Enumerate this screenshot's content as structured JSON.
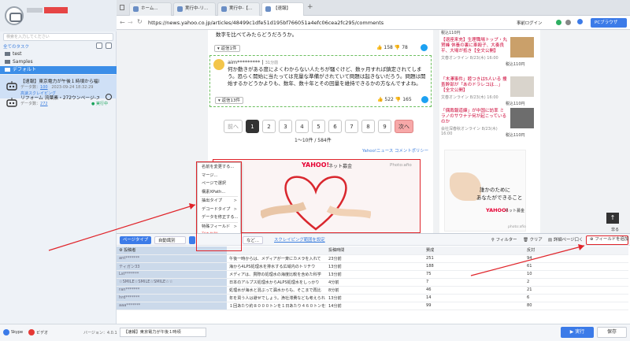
{
  "sidebar": {
    "search_placeholder": "検索を入力してください",
    "section_label": "全てのタスク",
    "folders": [
      "test",
      "Samples",
      "デフォルト"
    ],
    "tasks": [
      {
        "title": "【速報】東京電力が午後１時頃から福島第...",
        "meta_label": "データ数：",
        "meta_count": "100",
        "meta_time": "2023-09-24 18:32:29",
        "status": "高速スクレイピング"
      },
      {
        "title": "リフォーム 流葉素・272ウンページ-スクレ...",
        "meta_label": "データ数：",
        "meta_count": "272",
        "status": "● 実行中"
      }
    ],
    "footer": {
      "brand": "Skype",
      "links": "ビデオ",
      "version": "バージョン：4.0.1"
    }
  },
  "browser": {
    "tabs": [
      {
        "label": "ホーム...",
        "active": false
      },
      {
        "label": "実行中-リ...",
        "active": false
      },
      {
        "label": "実行中-【...",
        "active": false
      },
      {
        "label": "【速報】",
        "active": true
      }
    ],
    "url": "https://news.yahoo.co.jp/articles/48499c1dfe51d195bf766051a4efc06cea2fc295/comments",
    "login_label": "事前ログイン",
    "browser_mode": "PCブラウザ"
  },
  "page": {
    "comment1_tail": "数字を比べてみたらどうだろうか。",
    "reply_label": "返信1件",
    "c1_up": "158",
    "c1_down": "78",
    "user2": "aim*********",
    "user2_time": "31分前",
    "comment2": "何か動きがある度によくわからない人たちが騒ぐけど、数ヶ月すれば鎮定されてしまう。恐らく開始に当たっては充量な準備がされていて問題は起きないだろう。問題は開始するかどうかよりも、数年、数十年とその回量を維持できるかの方なんですよね。",
    "reply2_label": "返信13件",
    "c2_up": "522",
    "c2_down": "165",
    "pagination": {
      "prev": "前へ",
      "next": "次へ",
      "pages": [
        "1",
        "2",
        "3",
        "4",
        "5",
        "6",
        "7",
        "8",
        "9"
      ]
    },
    "count_text": "1〜10件 / 584件",
    "policy_link": "Yahoo!ニュース コメントポリシー",
    "ad_logo": "YAHOO!",
    "ad_sub": "ネット募金",
    "ad_photo": "Photo:afio",
    "ad2_text1": "誰かのために",
    "ad2_text2": "あなたができること",
    "ad2_logo": "YAHOO!",
    "ad2_sub": "ネット募金",
    "ad2_photo": "photo:afio"
  },
  "news": [
    {
      "title": "【退座来充】生理職場トップ・丸賀峰 休養の裏に車殴子、大奏良平、大場が抵き【全文公開】",
      "source": "文春オンライン 8/23(木) 16:00",
      "price": "税込110円"
    },
    {
      "title": "「木澤事件」睦つきは5人いる 捜査幹部が「あのドラレコは…」【全文公開】",
      "source": "文春オンライン 8/23(木) 16:00",
      "price": "税込110円"
    },
    {
      "title": "「偶裁報道練」が中国に訪率 ミラノのサウナテ何が起こっているのか",
      "source": "会社深春秋オンライン 8/23(木) 16:00",
      "price": "税込110円"
    }
  ],
  "context_menu": {
    "items": [
      "名前を変更する...",
      "マージ...",
      "ページで選択",
      "構素XPath...",
      "抽出タイプ",
      "デコードタイプ",
      "データを修正する...",
      "特殊フィールド",
      "列を削除"
    ]
  },
  "panel": {
    "tab_label": "ページタイプ",
    "select_value": "自動識別",
    "dropdown_suffix": "など...",
    "scroll_link": "スクレイピング範囲を設定",
    "filter": "フィルター",
    "clear": "クリア",
    "detail": "詳細ページ口く",
    "add_field": "フィールドを追加",
    "close_label": "非る",
    "columns": [
      "投稿者",
      "",
      "投稿時間",
      "賛成",
      "反対"
    ],
    "rows": [
      [
        "ant*******",
        "午後一時からは、メディアが一斉にカメラを入れて",
        "23分前",
        "251",
        "94"
      ],
      [
        "ティガン33",
        "海から4LPS処理水を排水する広域内のトリチウ",
        "13分前",
        "188",
        "61"
      ],
      [
        "Lst*******",
        "メディアは、貫際の処理水の海度比較を含めた科学",
        "13分前",
        "75",
        "10"
      ],
      [
        "☆SMILE☆SMILE☆SMILE☆☆",
        "日本のアルプス処理水からALPS処理水をしっかり",
        "4分前",
        "7",
        "2"
      ],
      [
        "ran*******",
        "処理水が海水と混ぶって漏水からも、そこまで再比",
        "8分前",
        "46",
        "21"
      ],
      [
        "hrd*******",
        "年を買う人は避せでしょう。漁社滞費なども考えられ",
        "13分前",
        "14",
        "6"
      ],
      [
        "aaa*******",
        "１回あたり約８０００トンを１日あたり４６０トンを排",
        "14分前",
        "99",
        "80"
      ]
    ]
  },
  "status": {
    "open_tab": "【速報】東京電力が午後１時頃",
    "run": "実行",
    "save": "保存"
  },
  "colors": {
    "accent": "#3c7be8",
    "highlight": "#e0242a",
    "selected_task": "#cfe0f6"
  }
}
